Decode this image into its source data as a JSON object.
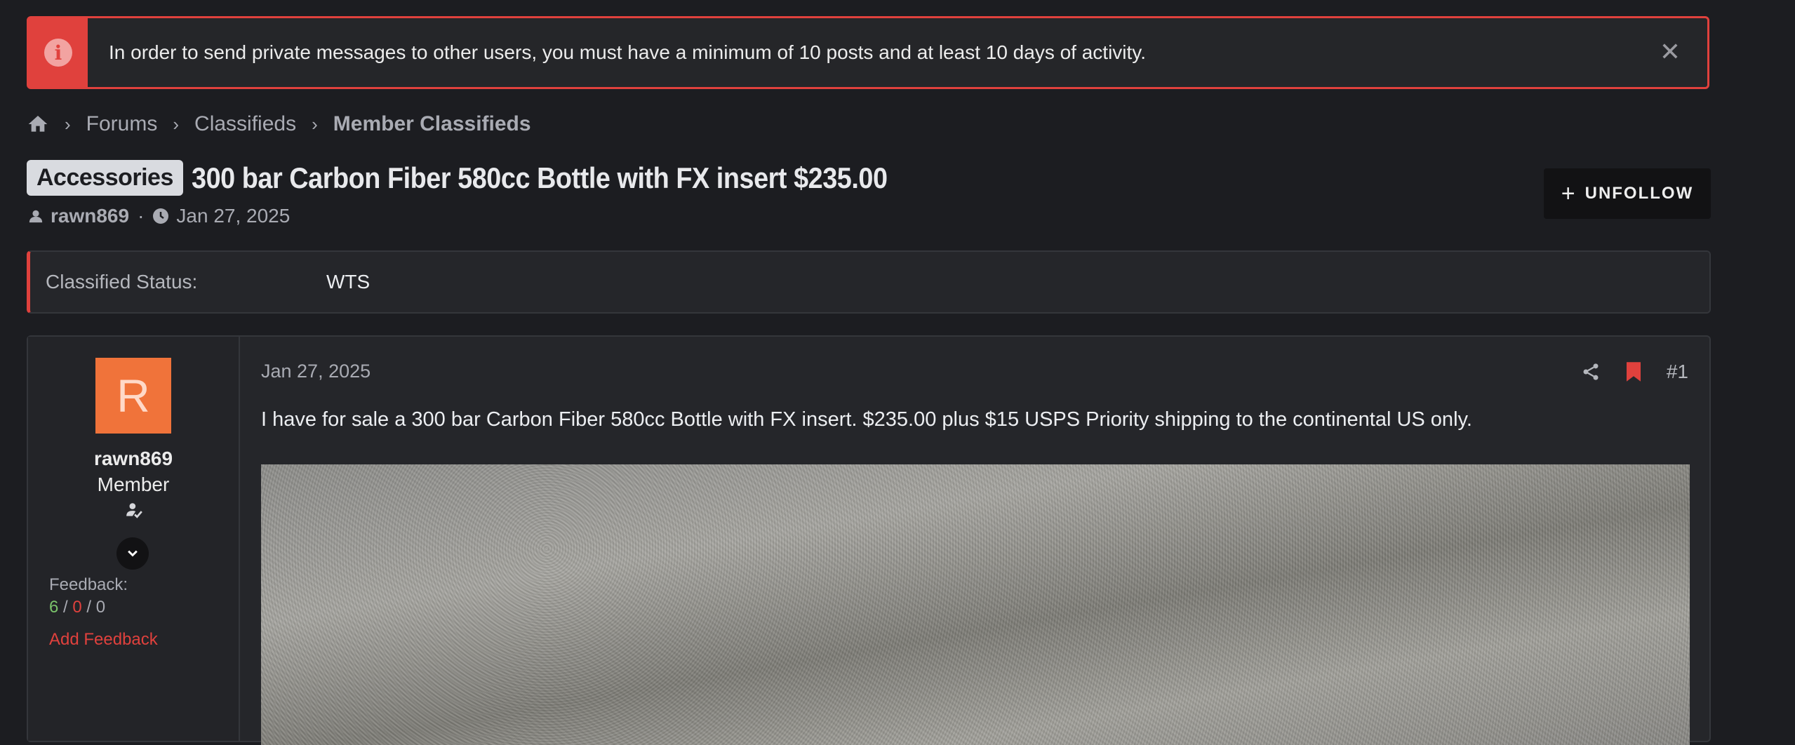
{
  "notice": {
    "text": "In order to send private messages to other users, you must have a minimum of 10 posts and at least 10 days of activity.",
    "close": "✕"
  },
  "breadcrumb": {
    "items": [
      "Forums",
      "Classifieds",
      "Member Classifieds"
    ]
  },
  "thread": {
    "prefix": "Accessories",
    "title": "300 bar Carbon Fiber 580cc Bottle with FX insert $235.00",
    "author": "rawn869",
    "date": "Jan 27, 2025",
    "unfollow_label": "UNFOLLOW"
  },
  "status": {
    "label": "Classified Status:",
    "value": "WTS"
  },
  "post": {
    "avatar_letter": "R",
    "username": "rawn869",
    "role": "Member",
    "feedback_label": "Feedback:",
    "feedback_positive": "6",
    "feedback_negative": "0",
    "feedback_neutral": "0",
    "add_feedback": "Add Feedback",
    "date": "Jan 27, 2025",
    "number": "#1",
    "body": "I have for sale a 300 bar Carbon Fiber 580cc Bottle with FX insert. $235.00 plus $15 USPS Priority shipping to the continental US only."
  },
  "colors": {
    "accent": "#e0413d",
    "avatar_bg": "#f0733a",
    "positive": "#7ac36b"
  }
}
